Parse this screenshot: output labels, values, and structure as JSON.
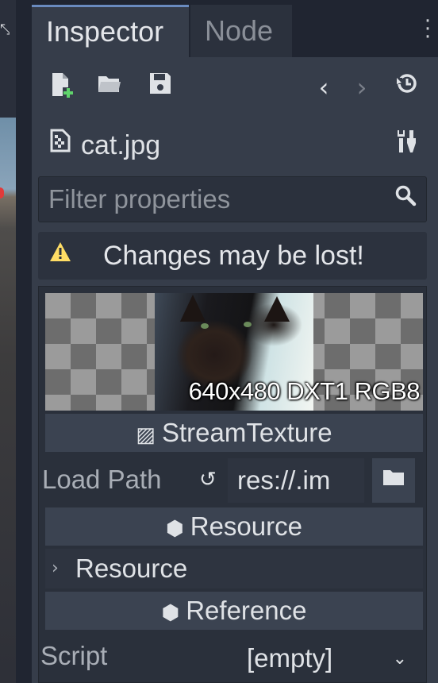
{
  "tabs": [
    {
      "label": "Inspector"
    },
    {
      "label": "Node"
    }
  ],
  "toolbar": {
    "icons": [
      "new-resource-icon",
      "open-folder-icon",
      "save-icon",
      "history-back-icon",
      "history-forward-icon",
      "history-icon"
    ]
  },
  "resource": {
    "name": "cat.jpg",
    "icon": "texture-icon"
  },
  "filter": {
    "placeholder": "Filter properties",
    "value": ""
  },
  "warning": {
    "text": "Changes may be lost!"
  },
  "preview": {
    "label": "640x480 DXT1 RGB8"
  },
  "sections": {
    "type_header": "StreamTexture",
    "resource_header": "Resource",
    "resource_group": "Resource",
    "reference_header": "Reference"
  },
  "properties": {
    "load_path_label": "Load Path",
    "load_path_value": "res://.im",
    "script_label": "Script",
    "script_value": "[empty]"
  },
  "colors": {
    "accent": "#6a8bbf",
    "warning": "#ffdd65",
    "add_green": "#5fd36b"
  }
}
